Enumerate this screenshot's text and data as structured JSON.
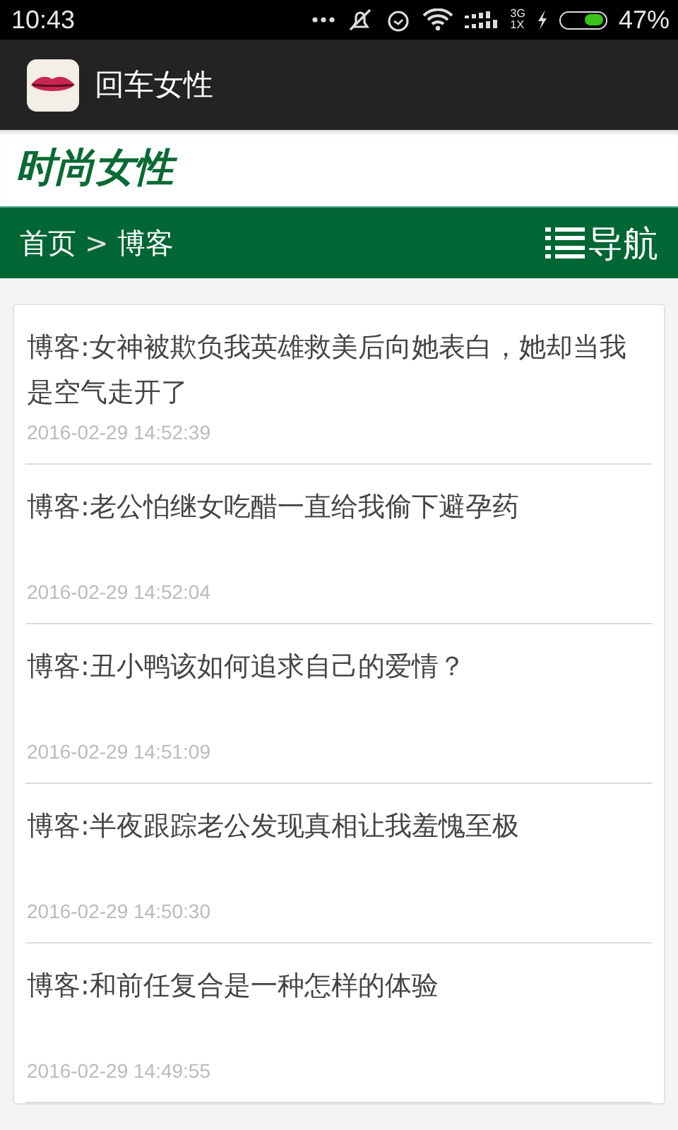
{
  "status_bar": {
    "time": "10:43",
    "network_top": "3G",
    "network_bottom": "1X",
    "battery_text": "47%",
    "battery": {
      "level": 0.47
    }
  },
  "app_bar": {
    "title": "回车女性"
  },
  "site": {
    "title": "时尚女性"
  },
  "breadcrumb": {
    "items": [
      "首页",
      "博客"
    ],
    "separator": ">",
    "nav_label": "导航"
  },
  "posts": [
    {
      "title": "博客:女神被欺负我英雄救美后向她表白，她却当我是空气走开了",
      "date": "2016-02-29 14:52:39"
    },
    {
      "title": "博客:老公怕继女吃醋一直给我偷下避孕药",
      "date": "2016-02-29 14:52:04"
    },
    {
      "title": "博客:丑小鸭该如何追求自己的爱情？",
      "date": "2016-02-29 14:51:09"
    },
    {
      "title": "博客:半夜跟踪老公发现真相让我羞愧至极",
      "date": "2016-02-29 14:50:30"
    },
    {
      "title": "博客:和前任复合是一种怎样的体验",
      "date": "2016-02-29 14:49:55"
    }
  ]
}
